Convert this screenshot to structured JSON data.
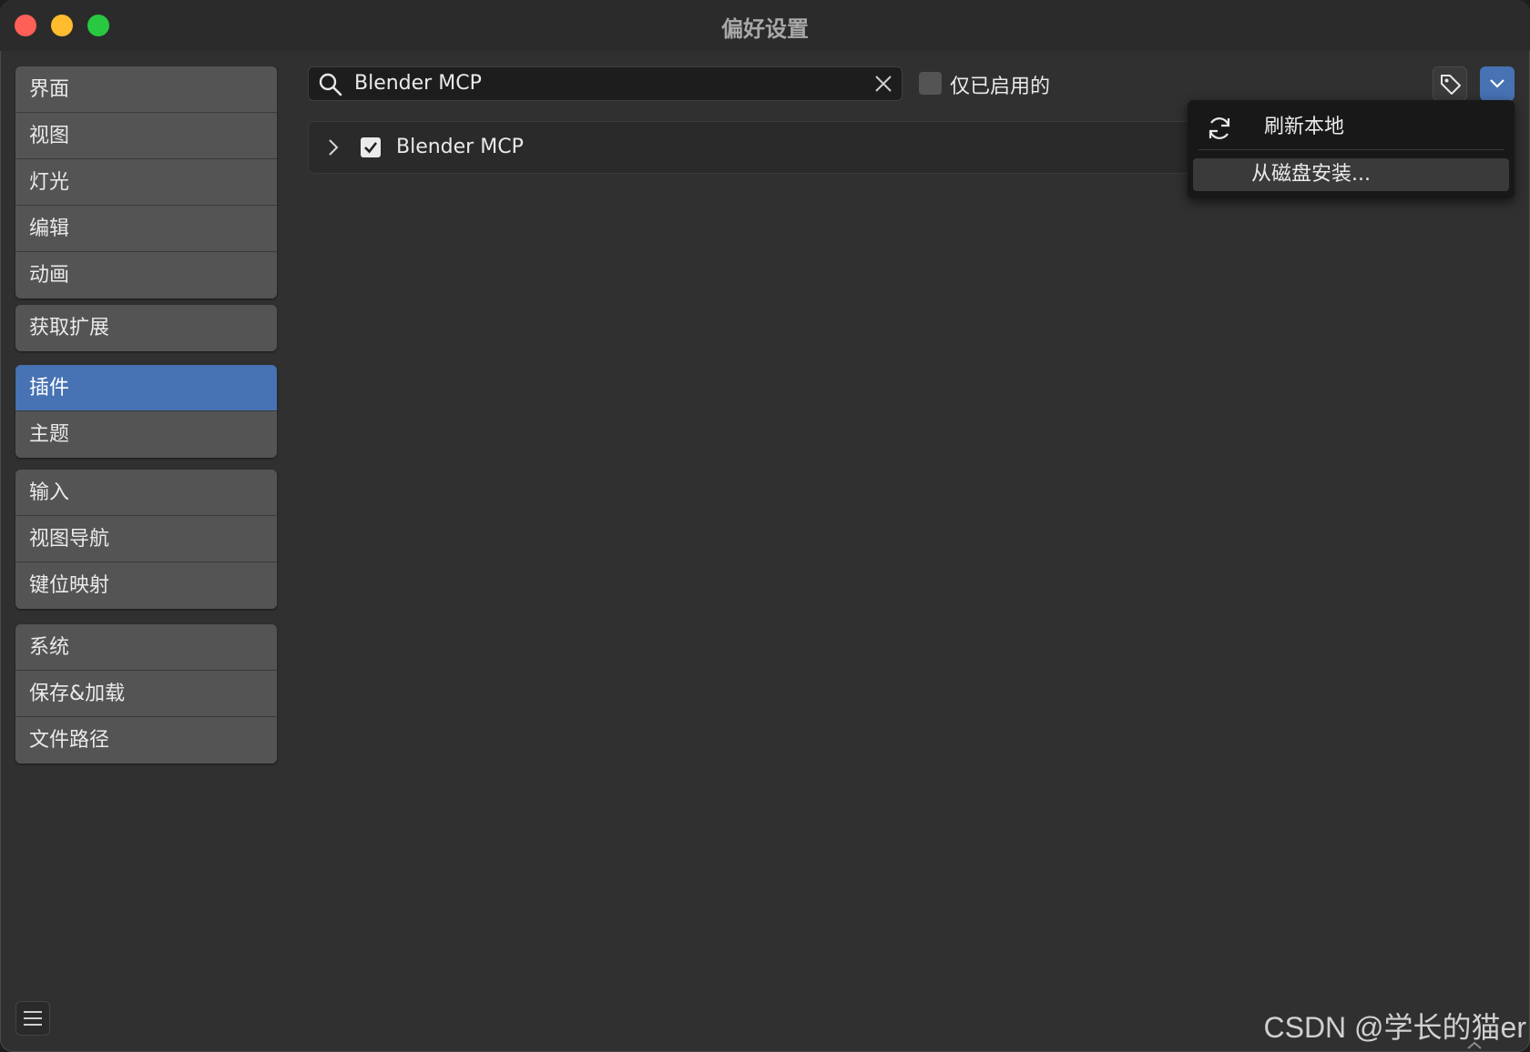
{
  "window": {
    "title": "偏好设置"
  },
  "sidebar": {
    "groups": [
      {
        "items": [
          {
            "label": "界面"
          },
          {
            "label": "视图"
          },
          {
            "label": "灯光"
          },
          {
            "label": "编辑"
          },
          {
            "label": "动画"
          }
        ]
      },
      {
        "items": [
          {
            "label": "获取扩展"
          }
        ]
      },
      {
        "items": [
          {
            "label": "插件",
            "active": true
          },
          {
            "label": "主题"
          }
        ]
      },
      {
        "items": [
          {
            "label": "输入"
          },
          {
            "label": "视图导航"
          },
          {
            "label": "键位映射"
          }
        ]
      },
      {
        "items": [
          {
            "label": "系统"
          },
          {
            "label": "保存&加载"
          },
          {
            "label": "文件路径"
          }
        ]
      }
    ]
  },
  "search": {
    "value": "Blender MCP",
    "icon": "search-icon",
    "clear_icon": "close-icon"
  },
  "filter": {
    "only_enabled_label": "仅已启用的",
    "only_enabled_checked": false
  },
  "toolbar": {
    "tag_icon": "tag-icon",
    "dropdown_icon": "chevron-down-icon"
  },
  "addons": [
    {
      "name": "Blender MCP",
      "enabled": true,
      "expanded": false
    }
  ],
  "dropdown_menu": {
    "items": [
      {
        "label": "刷新本地",
        "icon": "refresh-icon"
      },
      {
        "label": "从磁盘安装..."
      }
    ]
  },
  "footer": {
    "menu_icon": "hamburger-menu-icon"
  },
  "watermark": "CSDN @学长的猫er",
  "colors": {
    "accent": "#4772b3",
    "window_bg": "#303030",
    "sidebar_item": "#545454"
  }
}
